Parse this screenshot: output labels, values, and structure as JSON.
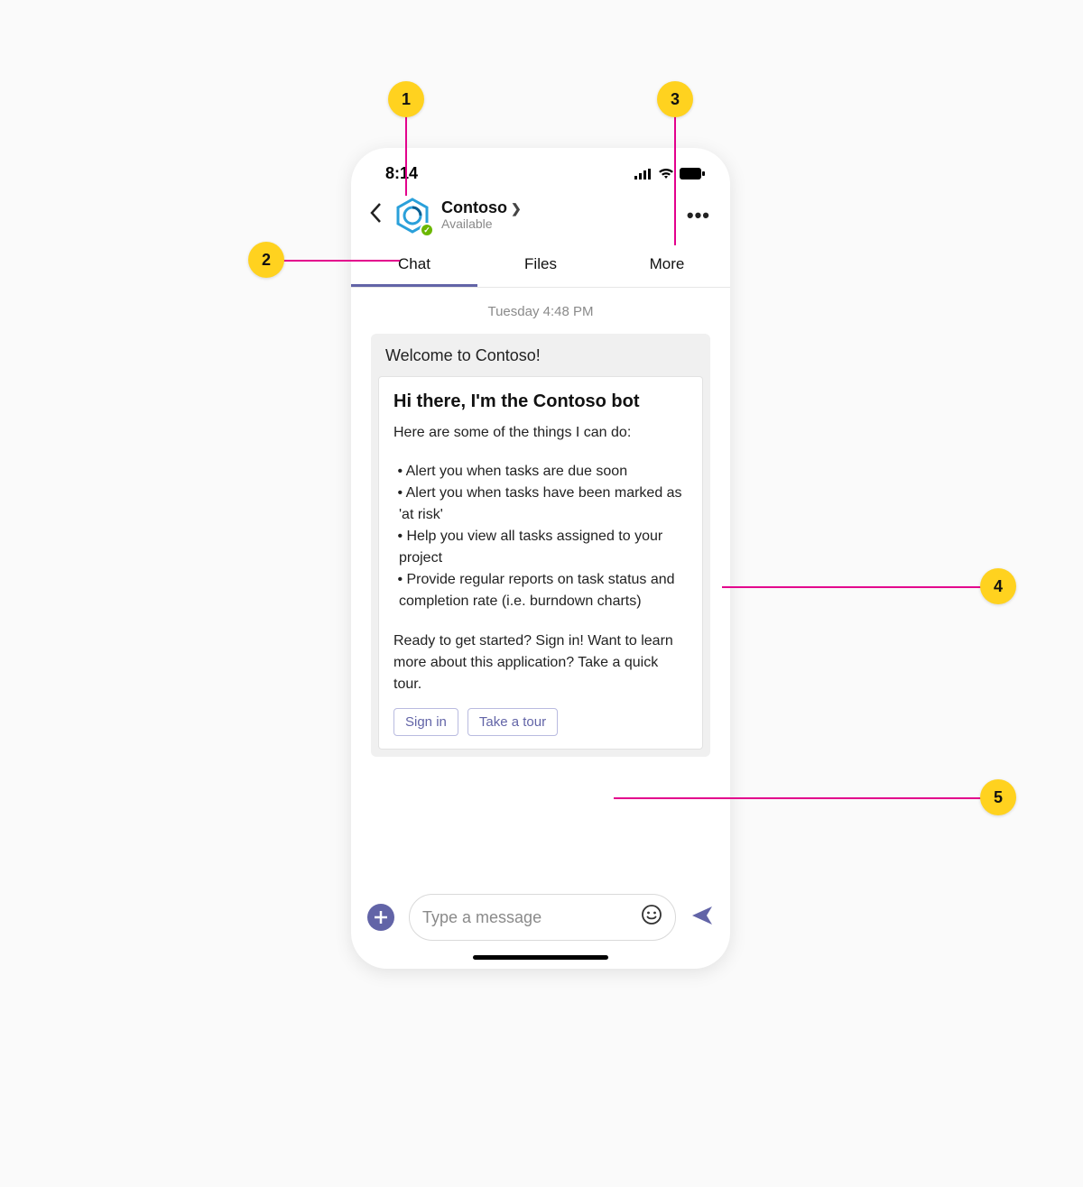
{
  "status_bar": {
    "time": "8:14"
  },
  "header": {
    "title": "Contoso",
    "subtitle": "Available"
  },
  "tabs": [
    {
      "label": "Chat",
      "active": true
    },
    {
      "label": "Files",
      "active": false
    },
    {
      "label": "More",
      "active": false
    }
  ],
  "timeline": {
    "timestamp": "Tuesday 4:48 PM",
    "card": {
      "header": "Welcome to Contoso!",
      "title": "Hi there, I'm the Contoso bot",
      "intro": "Here are some of the things I can do:",
      "bullets": [
        "Alert you when tasks are due soon",
        "Alert you when tasks have been marked as 'at risk'",
        "Help you view all tasks assigned to your project",
        "Provide regular reports on task status and completion rate  (i.e. burndown charts)"
      ],
      "outro": "Ready to get started? Sign in! Want to learn more about this application? Take a quick tour.",
      "actions": [
        {
          "label": "Sign in"
        },
        {
          "label": "Take a tour"
        }
      ]
    }
  },
  "composer": {
    "placeholder": "Type a message"
  },
  "callouts": [
    {
      "n": "1"
    },
    {
      "n": "2"
    },
    {
      "n": "3"
    },
    {
      "n": "4"
    },
    {
      "n": "5"
    }
  ]
}
